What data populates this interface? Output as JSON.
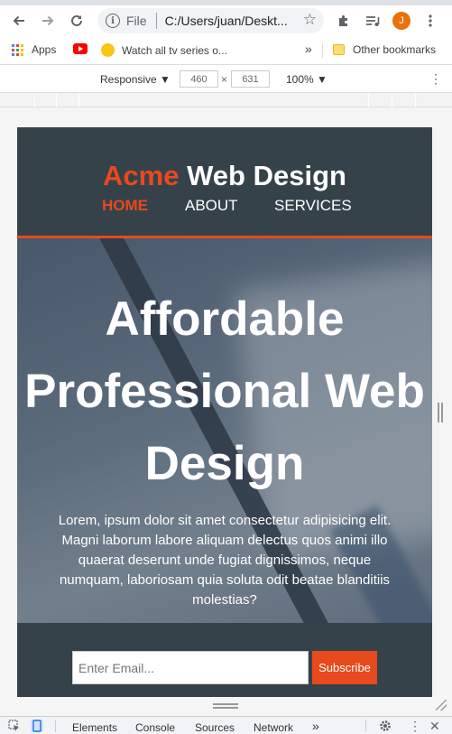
{
  "browser": {
    "address_scheme": "File",
    "address_url": "C:/Users/juan/Deskt...",
    "profile_initial": "J",
    "bookmarks": {
      "apps": "Apps",
      "watch": "Watch all tv series o...",
      "overflow": "»",
      "other": "Other bookmarks"
    }
  },
  "device_toolbar": {
    "mode": "Responsive",
    "width": "460",
    "height": "631",
    "times": "×",
    "zoom": "100%"
  },
  "site": {
    "brand_highlight": "Acme",
    "brand_rest": " Web Design",
    "nav": [
      "HOME",
      "ABOUT",
      "SERVICES"
    ],
    "current_nav": "HOME",
    "headline": "Affordable Professional Web Design",
    "lede": "Lorem, ipsum dolor sit amet consectetur adipisicing elit. Magni laborum labore aliquam delectus quos animi illo quaerat deserunt unde fugiat dignissimos, neque numquam, laboriosam quia soluta odit beatae blanditiis molestias?",
    "email_placeholder": "Enter Email...",
    "subscribe_label": "Subscribe",
    "accent_color": "#e8491d",
    "header_color": "#35424a"
  },
  "devtools": {
    "tabs": [
      "Elements",
      "Console",
      "Sources",
      "Network"
    ],
    "more": "»"
  },
  "icons": {
    "back": "back-arrow-icon",
    "forward": "forward-arrow-icon",
    "reload": "reload-icon",
    "star": "star-icon",
    "extensions": "puzzle-icon",
    "media": "media-queue-icon",
    "menu": "kebab-icon"
  }
}
